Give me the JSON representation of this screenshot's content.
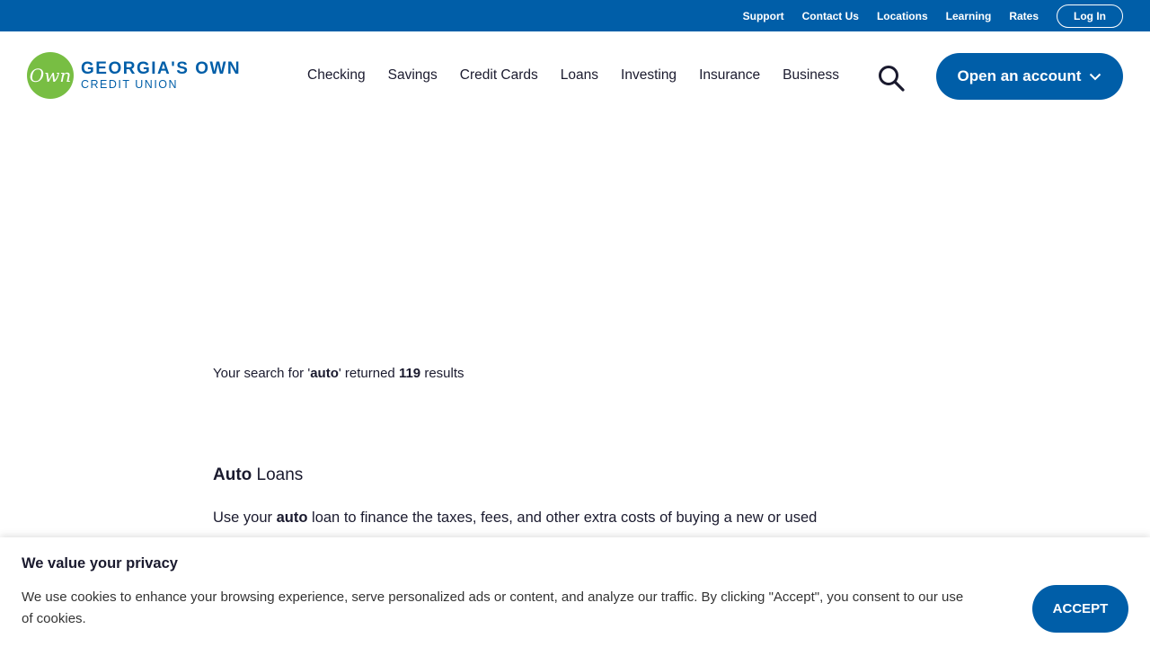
{
  "utility_nav": {
    "links": [
      "Support",
      "Contact Us",
      "Locations",
      "Learning",
      "Rates"
    ],
    "login_label": "Log In"
  },
  "logo": {
    "mark": "Own",
    "line1": "GEORGIA'S OWN",
    "line2": "CREDIT UNION"
  },
  "main_nav": {
    "items": [
      "Checking",
      "Savings",
      "Credit Cards",
      "Loans",
      "Investing",
      "Insurance",
      "Business"
    ],
    "search_icon": "search-icon",
    "cta_label": "Open an account",
    "cta_icon": "chevron-down-icon"
  },
  "search": {
    "prefix": "Your search for '",
    "query": "auto",
    "middle": "' returned ",
    "count": "119",
    "suffix": " results"
  },
  "results": [
    {
      "title_highlight": "Auto",
      "title_rest": " Loans",
      "desc_prefix": "Use your ",
      "desc_highlight": "auto",
      "desc_rest": " loan to finance the taxes, fees, and other extra costs of buying a new or used"
    }
  ],
  "cookie_banner": {
    "title": "We value your privacy",
    "text": "We use cookies to enhance your browsing experience, serve personalized ads or content, and analyze our traffic. By clicking \"Accept\", you consent to our use of cookies.",
    "accept_label": "ACCEPT"
  },
  "colors": {
    "brand_blue": "#005ea8",
    "logo_green": "#78be43",
    "text_dark": "#1a1a2e"
  }
}
